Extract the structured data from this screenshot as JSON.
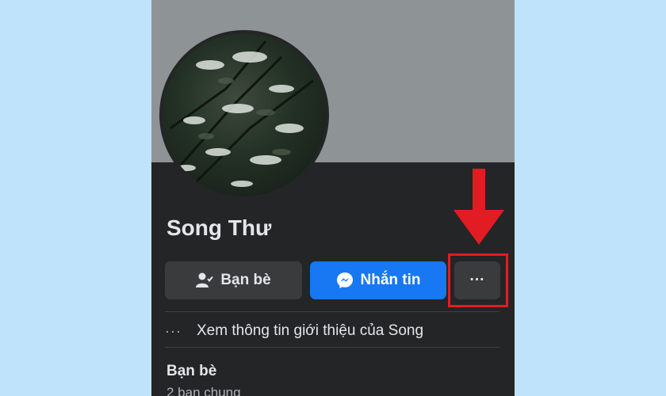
{
  "profile": {
    "name": "Song Thư"
  },
  "actions": {
    "friends_label": "Bạn bè",
    "message_label": "Nhắn tin",
    "more_label": "···"
  },
  "intro": {
    "label": "Xem thông tin giới thiệu của Song",
    "dots": "···"
  },
  "friends_section": {
    "title": "Bạn bè",
    "mutual": "2 bạn chung"
  },
  "icons": {
    "friends": "person-check-icon",
    "message": "messenger-icon",
    "more": "more-dots-icon",
    "intro": "more-dots-icon",
    "annotation": "down-arrow-icon"
  },
  "colors": {
    "background": "#bfe3fb",
    "panel": "#242526",
    "button": "#3a3b3c",
    "primary": "#1877f2",
    "highlight": "#e31b23"
  }
}
